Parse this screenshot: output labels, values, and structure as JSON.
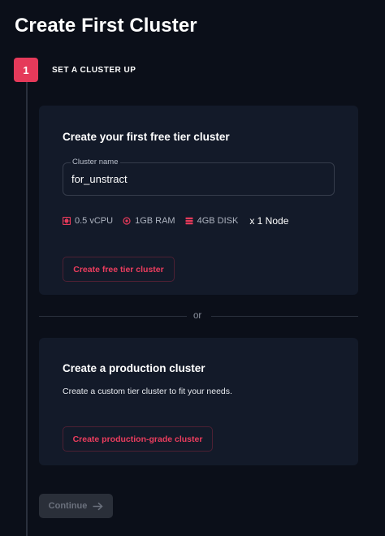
{
  "header": {
    "title": "Create First Cluster"
  },
  "stepper": {
    "step_number": "1",
    "step_label": "SET A CLUSTER UP"
  },
  "free_tier": {
    "title": "Create your first free tier cluster",
    "cluster_name_label": "Cluster name",
    "cluster_name_value": "for_unstract",
    "specs": {
      "vcpu": "0.5 vCPU",
      "ram": "1GB RAM",
      "disk": "4GB DISK",
      "nodes": "x 1 Node"
    },
    "button_label": "Create free tier cluster"
  },
  "divider": {
    "text": "or"
  },
  "production": {
    "title": "Create a production cluster",
    "description": "Create a custom tier cluster to fit your needs.",
    "button_label": "Create production-grade cluster"
  },
  "footer": {
    "continue_label": "Continue",
    "continue_disabled": true
  },
  "colors": {
    "accent": "#e53a5a",
    "background": "#0b0f19",
    "card": "#131a29"
  }
}
